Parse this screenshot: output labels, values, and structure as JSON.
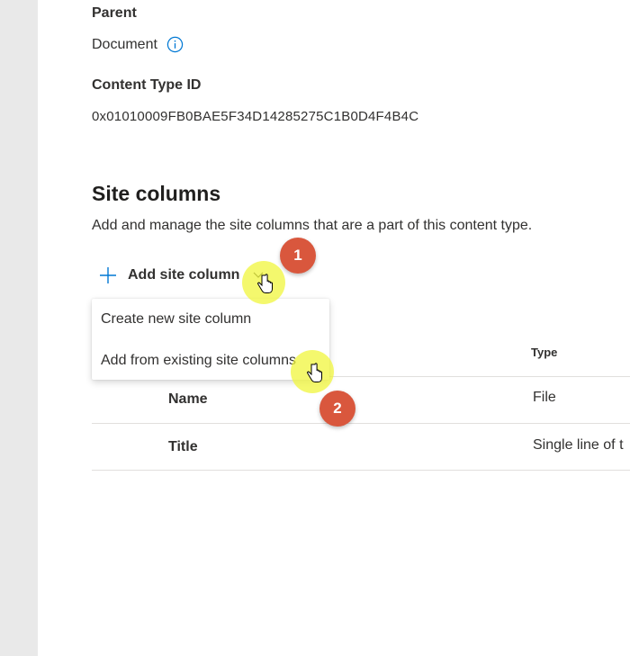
{
  "details": {
    "parent_label": "Parent",
    "parent_value": "Document",
    "content_type_id_label": "Content Type ID",
    "content_type_id_value": "0x01010009FB0BAE5F34D14285275C1B0D4F4B4C"
  },
  "site_columns": {
    "title": "Site columns",
    "description": "Add and manage the site columns that are a part of this content type.",
    "add_button_label": "Add site column",
    "menu": [
      {
        "label": "Create new site column"
      },
      {
        "label": "Add from existing site columns"
      }
    ],
    "type_header": "Type",
    "rows": [
      {
        "name": "Name",
        "type": "File"
      },
      {
        "name": "Title",
        "type": "Single line of t"
      }
    ]
  },
  "annotations": {
    "step1": "1",
    "step2": "2"
  },
  "icons": {
    "info": "info-icon",
    "plus": "plus-icon",
    "chevron": "chevron-down-icon",
    "cursor": "hand-pointer-icon"
  },
  "colors": {
    "accent": "#0078d4",
    "badge": "#d9573d",
    "highlight": "#f0f53c",
    "rail": "#e9e9e9"
  }
}
